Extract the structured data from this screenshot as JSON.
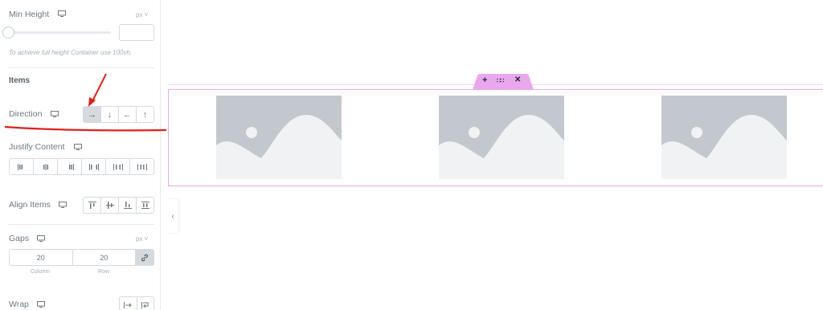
{
  "panel": {
    "min_height": {
      "label": "Min Height",
      "unit": "px",
      "hint": "To achieve full height Container use 100vh."
    },
    "items_heading": "Items",
    "direction": {
      "label": "Direction",
      "options": [
        "→",
        "↓",
        "←",
        "↑"
      ],
      "active_index": 0
    },
    "justify_content": {
      "label": "Justify Content",
      "options": [
        "|||",
        "|||",
        "|||",
        "|||",
        "|||",
        "|||"
      ]
    },
    "align_items": {
      "label": "Align Items",
      "options": [
        "⊤",
        "⊢",
        "⊥",
        "⊥"
      ]
    },
    "gaps": {
      "label": "Gaps",
      "unit": "px",
      "column_value": "20",
      "row_value": "20",
      "column_label": "Column",
      "row_label": "Row"
    },
    "wrap": {
      "label": "Wrap"
    }
  },
  "canvas": {
    "toolbar": {
      "add": "+",
      "drag": "∷∷",
      "close": "✕"
    },
    "image_placeholders": 3
  },
  "colors": {
    "accent": "#e9a8ee",
    "annotation": "#e0201c",
    "placeholder_bg": "#c2c8ce",
    "placeholder_fg": "#f1f2f3"
  },
  "icons": {
    "device": "desktop-monitor-icon",
    "collapse": "chevron-left-icon",
    "link": "link-icon"
  }
}
